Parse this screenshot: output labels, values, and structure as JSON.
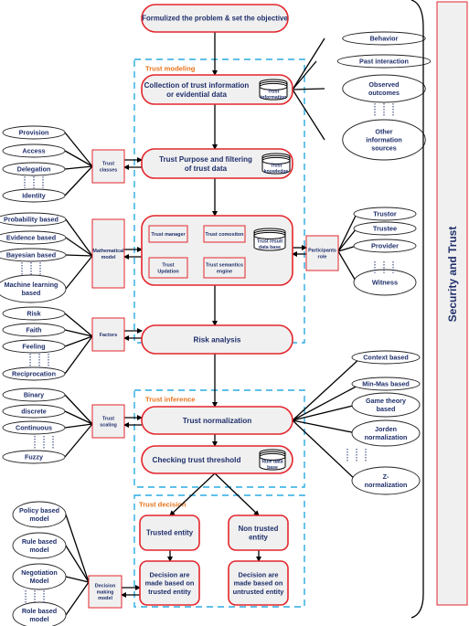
{
  "side_panel": {
    "title": "Security and Trust"
  },
  "stages": {
    "trust_modeling": "Trust modeling",
    "trust_inference": "Trust inference",
    "trust_decision": "Trust decision"
  },
  "process": {
    "formulize": "Formulized the problem & set the objective",
    "collection": [
      "Collection of trust information",
      "or evidential data"
    ],
    "purpose": [
      "Trust Purpose and filtering",
      "of trust data"
    ],
    "risk_analysis": "Risk analysis",
    "normalization": "Trust normalization",
    "threshold": "Checking trust threshold",
    "trusted_entity": "Trusted entity",
    "non_trusted_entity": [
      "Non trusted",
      "entity"
    ],
    "decision_trusted": [
      "Decision are",
      "made based on",
      "trusted entity"
    ],
    "decision_untrusted": [
      "Decision are",
      "made based on",
      "untrusted entity"
    ]
  },
  "databases": {
    "trust_information": [
      "Trust",
      "information"
    ],
    "trust_knowledge": [
      "Trust",
      "knowledge"
    ],
    "trust_result": [
      "Trust result",
      "data base"
    ],
    "rule_data": [
      "Rule data",
      "base"
    ]
  },
  "core_components": {
    "manager": "Trust manager",
    "composition": "Trust comositon",
    "updation": [
      "Trust",
      "Updation"
    ],
    "semantics": [
      "Trust semantics",
      "engine"
    ]
  },
  "connectors": {
    "trust_classes": [
      "Trust",
      "classes"
    ],
    "mathematical_model": [
      "Mathematical",
      "model"
    ],
    "factors": [
      "Factors"
    ],
    "trust_scaling": [
      "Trust",
      "scaling"
    ],
    "decision_making": [
      "Decision",
      "making",
      "model"
    ],
    "participants_role": [
      "Participants",
      "role"
    ]
  },
  "left_groups": {
    "trust_classes": [
      [
        "Provision"
      ],
      [
        "Access"
      ],
      [
        "Delegation"
      ],
      [
        "Identity"
      ]
    ],
    "mathematical_model": [
      [
        "Probability based"
      ],
      [
        "Evidence based"
      ],
      [
        "Bayesian based"
      ],
      [
        "Machine learning",
        "based"
      ]
    ],
    "factors": [
      [
        "Risk"
      ],
      [
        "Faith"
      ],
      [
        "Feeling"
      ],
      [
        "Reciprocation"
      ]
    ],
    "trust_scaling": [
      [
        "Binary"
      ],
      [
        "discrete"
      ],
      [
        "Continuous"
      ],
      [
        "Fuzzy"
      ]
    ],
    "decision_making": [
      [
        "Policy based",
        "model"
      ],
      [
        "Rule based",
        "model"
      ],
      [
        "Negotiation",
        "Model"
      ],
      [
        "Role based",
        "model"
      ]
    ]
  },
  "right_groups": {
    "trust_information_sources": [
      [
        "Behavior"
      ],
      [
        "Past interaction"
      ],
      [
        "Observed",
        "outcomes"
      ],
      [
        "Other",
        "information",
        "sources"
      ]
    ],
    "participants_role": [
      [
        "Trustor"
      ],
      [
        "Trustee"
      ],
      [
        "Provider"
      ],
      [
        "Witness"
      ]
    ],
    "normalization_methods": [
      [
        "Context based"
      ],
      [
        "Min-Mas based"
      ],
      [
        "Game theory",
        "based"
      ],
      [
        "Jorden",
        "normalization"
      ],
      [
        "Z-",
        "normalization"
      ]
    ]
  }
}
